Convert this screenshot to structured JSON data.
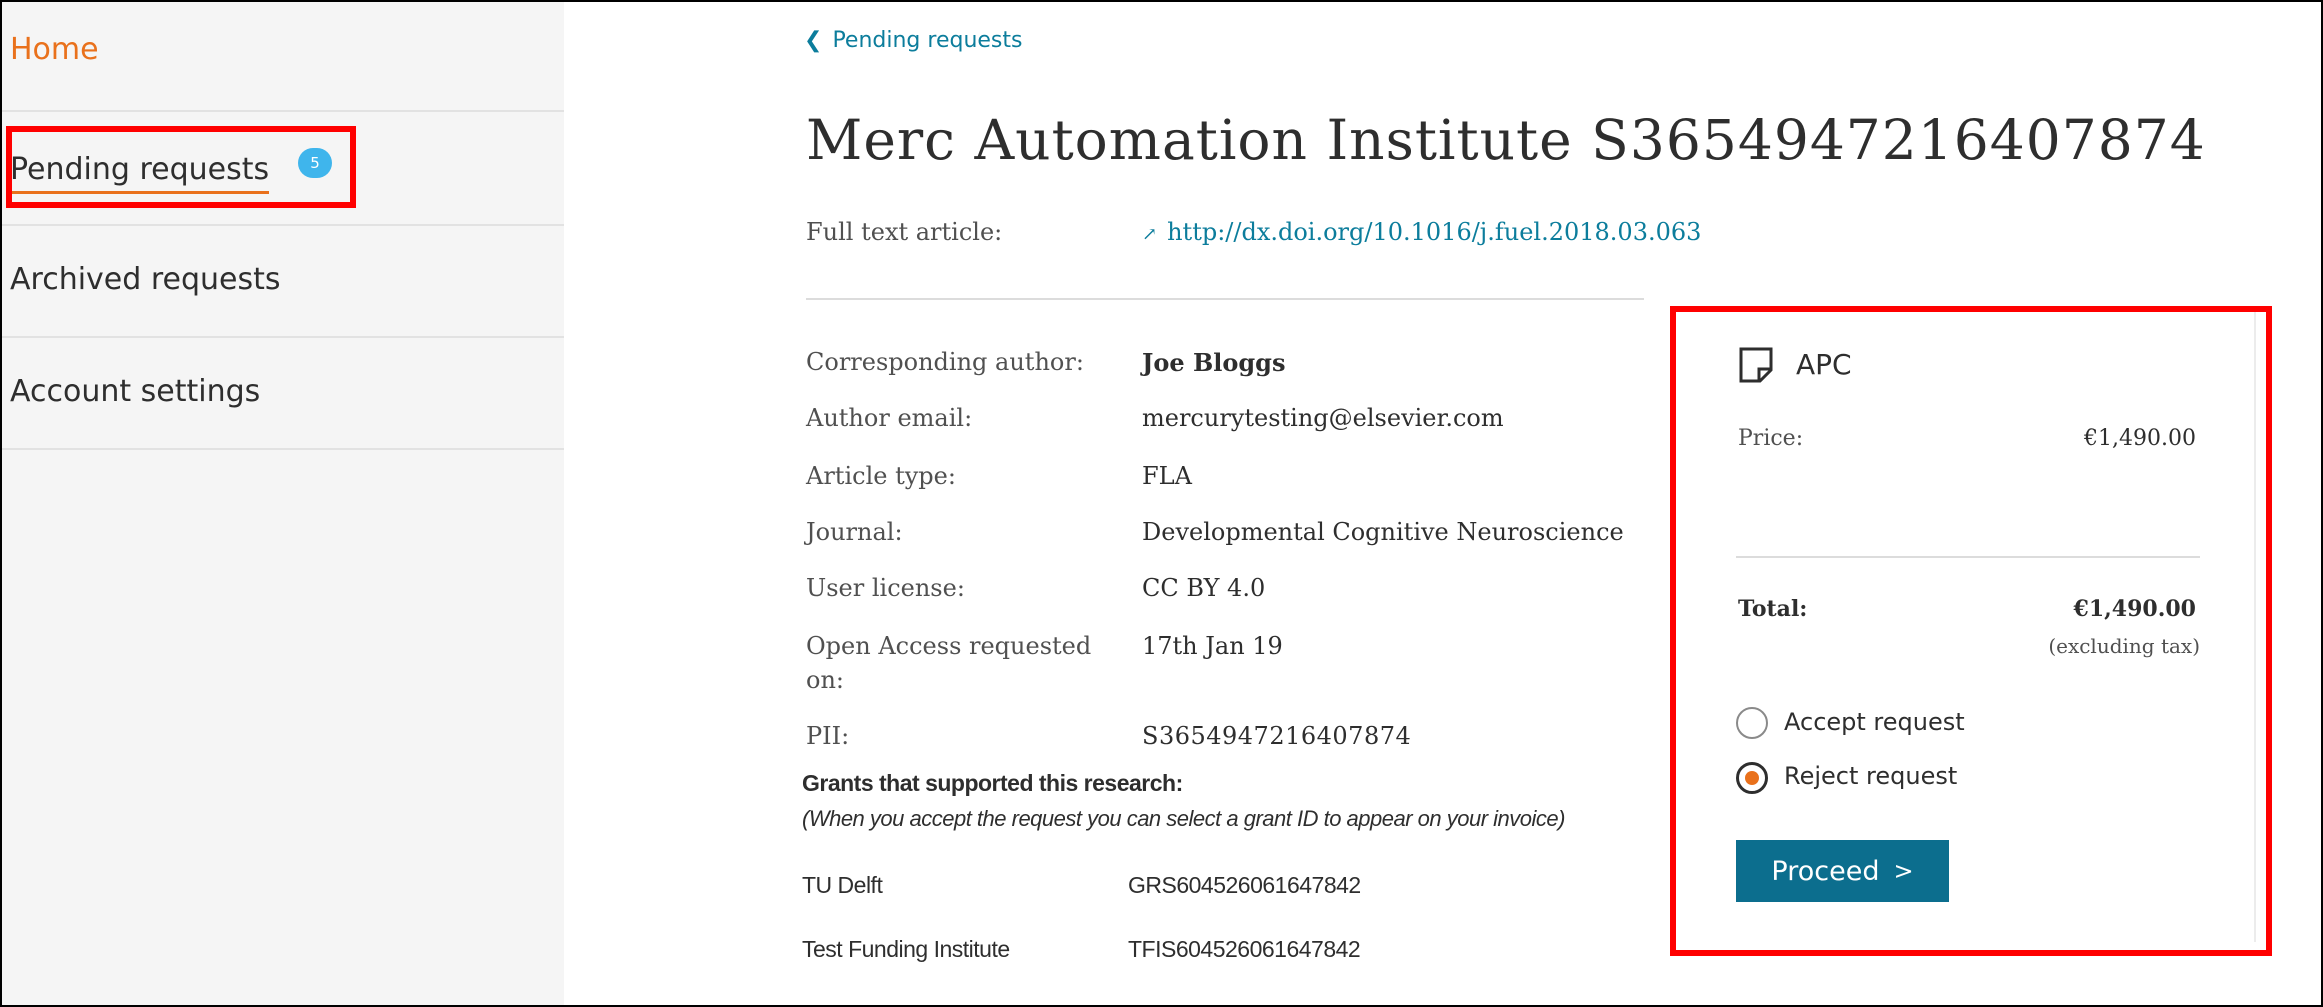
{
  "sidebar": {
    "items": [
      {
        "label": "Home"
      },
      {
        "label": "Pending requests",
        "badge": "5"
      },
      {
        "label": "Archived requests"
      },
      {
        "label": "Account settings"
      }
    ]
  },
  "main": {
    "back_link": "Pending requests",
    "title": "Merc Automation Institute S3654947216407874",
    "full_text": {
      "label": "Full text article:",
      "value": "http://dx.doi.org/10.1016/j.fuel.2018.03.063"
    },
    "details": [
      {
        "label": "Corresponding author:",
        "value": "Joe Bloggs"
      },
      {
        "label": "Author email:",
        "value": "mercurytesting@elsevier.com"
      },
      {
        "label": "Article type:",
        "value": "FLA"
      },
      {
        "label": "Journal:",
        "value": "Developmental Cognitive Neuroscience"
      },
      {
        "label": "User license:",
        "value": "CC BY 4.0"
      },
      {
        "label_line1": "Open Access requested",
        "label_line2": "on:",
        "value": "17th Jan 19"
      },
      {
        "label": "PII:",
        "value": "S3654947216407874"
      }
    ],
    "grants": {
      "title": "Grants that supported this research:",
      "note": "(When you accept the request you can select a grant ID to appear on your invoice)",
      "items": [
        {
          "name": "TU Delft",
          "id": "GRS604526061647842"
        },
        {
          "name": "Test Funding Institute",
          "id": "TFIS604526061647842"
        }
      ]
    }
  },
  "apc": {
    "title": "APC",
    "price_label": "Price:",
    "price_value": "€1,490.00",
    "total_label": "Total:",
    "total_value": "€1,490.00",
    "tax_note": "(excluding tax)",
    "options": [
      {
        "label": "Accept request",
        "selected": false
      },
      {
        "label": "Reject request",
        "selected": true
      }
    ],
    "proceed_label": "Proceed"
  },
  "colors": {
    "accent_orange": "#e9711c",
    "link_blue": "#0c7d9c",
    "button_blue": "#0c6e8e",
    "highlight_red": "#ff0000",
    "badge_blue": "#3fb5ec"
  }
}
